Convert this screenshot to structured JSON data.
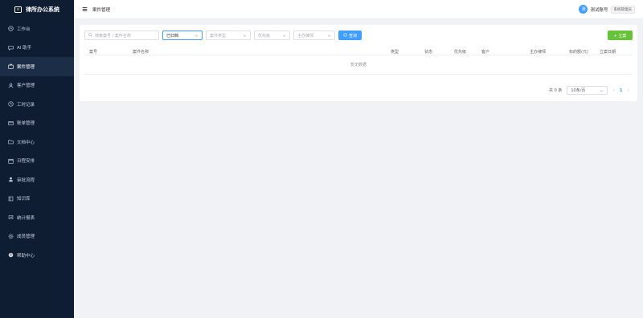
{
  "app": {
    "title": "律所办公系统",
    "logo_glyph": "☷"
  },
  "sidebar": {
    "items": [
      {
        "label": "工作台",
        "icon": "home-icon"
      },
      {
        "label": "AI 助手",
        "icon": "chat-icon"
      },
      {
        "label": "案件管理",
        "icon": "briefcase-icon",
        "active": true
      },
      {
        "label": "客户管理",
        "icon": "user-icon"
      },
      {
        "label": "工时记录",
        "icon": "clock-icon"
      },
      {
        "label": "账单管理",
        "icon": "bill-icon"
      },
      {
        "label": "文档中心",
        "icon": "folder-icon"
      },
      {
        "label": "日程安排",
        "icon": "calendar-icon"
      },
      {
        "label": "审批流程",
        "icon": "approve-icon"
      },
      {
        "label": "知识库",
        "icon": "book-icon"
      },
      {
        "label": "统计报表",
        "icon": "report-icon"
      },
      {
        "label": "成员管理",
        "icon": "gear-icon"
      },
      {
        "label": "帮助中心",
        "icon": "help-icon"
      }
    ]
  },
  "topbar": {
    "page_title": "案件管理",
    "user": {
      "avatar_text": "测",
      "name": "测试账号",
      "role": "系统管理员"
    }
  },
  "filters": {
    "search_placeholder": "搜索案号 / 案件名称",
    "status_value": "已归档",
    "type_placeholder": "案件类型",
    "priority_placeholder": "优先级",
    "lawyer_placeholder": "主办律师",
    "search_button": "查询"
  },
  "actions": {
    "new_button": "+ 立案"
  },
  "table": {
    "columns": [
      "案号",
      "案件名称",
      "类型",
      "状态",
      "优先级",
      "客户",
      "主办律师",
      "标的额(元)",
      "立案日期"
    ],
    "empty_text": "暂无数据"
  },
  "pagination": {
    "total_text": "共 0 条",
    "page_size": "10条/页",
    "current_page": "1",
    "prev": "‹",
    "next": "›"
  },
  "colors": {
    "sidebar_bg": "#0f1d33",
    "primary": "#409eff",
    "success": "#67c23a"
  }
}
